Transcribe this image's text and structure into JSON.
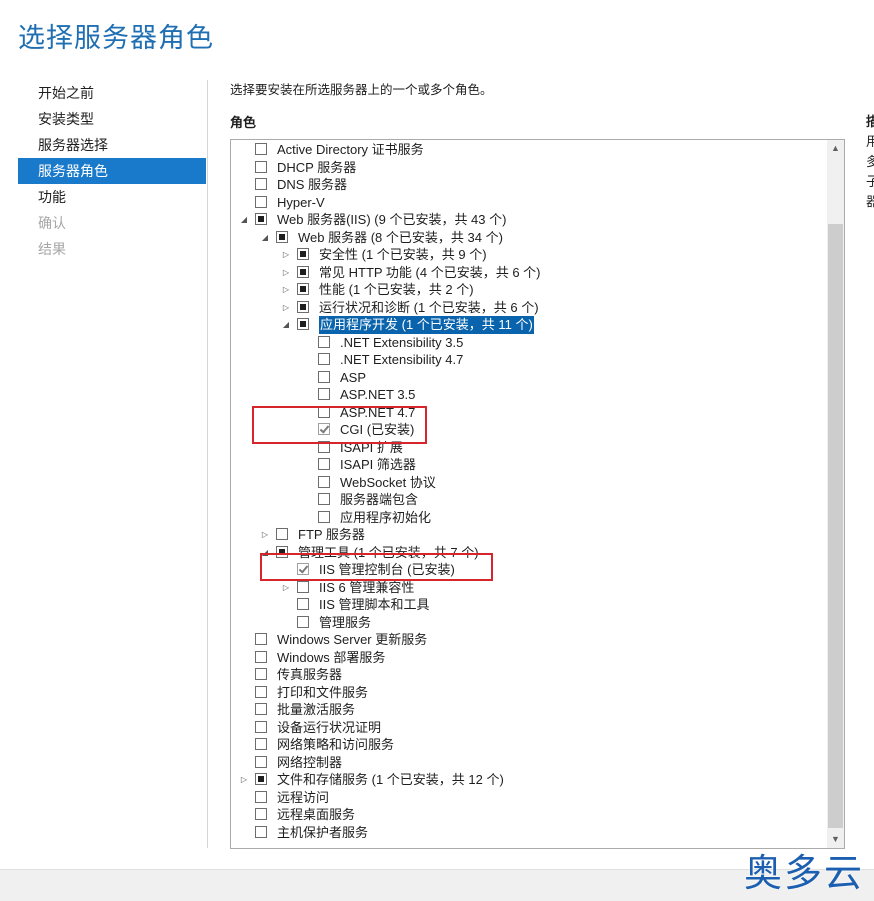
{
  "page": {
    "title": "选择服务器角色",
    "instruction": "选择要安装在所选服务器上的一个或多个角色。",
    "roles_label": "角色",
    "right_panel_fragment": [
      "描",
      "用",
      "多",
      "子",
      "器"
    ]
  },
  "nav": [
    {
      "label": "开始之前",
      "state": "normal"
    },
    {
      "label": "安装类型",
      "state": "normal"
    },
    {
      "label": "服务器选择",
      "state": "normal"
    },
    {
      "label": "服务器角色",
      "state": "selected"
    },
    {
      "label": "功能",
      "state": "normal"
    },
    {
      "label": "确认",
      "state": "disabled"
    },
    {
      "label": "结果",
      "state": "disabled"
    }
  ],
  "roles": [
    {
      "label": "Active Directory 证书服务",
      "level": 0,
      "state": "unchecked",
      "expander": "none"
    },
    {
      "label": "DHCP 服务器",
      "level": 0,
      "state": "unchecked",
      "expander": "none"
    },
    {
      "label": "DNS 服务器",
      "level": 0,
      "state": "unchecked",
      "expander": "none"
    },
    {
      "label": "Hyper-V",
      "level": 0,
      "state": "unchecked",
      "expander": "none"
    },
    {
      "label": "Web 服务器(IIS) (9 个已安装，共 43 个)",
      "level": 0,
      "state": "partial",
      "expander": "expanded"
    },
    {
      "label": "Web 服务器 (8 个已安装，共 34 个)",
      "level": 1,
      "state": "partial",
      "expander": "expanded"
    },
    {
      "label": "安全性 (1 个已安装，共 9 个)",
      "level": 2,
      "state": "partial",
      "expander": "collapsed"
    },
    {
      "label": "常见 HTTP 功能 (4 个已安装，共 6 个)",
      "level": 2,
      "state": "partial",
      "expander": "collapsed"
    },
    {
      "label": "性能 (1 个已安装，共 2 个)",
      "level": 2,
      "state": "partial",
      "expander": "collapsed"
    },
    {
      "label": "运行状况和诊断 (1 个已安装，共 6 个)",
      "level": 2,
      "state": "partial",
      "expander": "collapsed"
    },
    {
      "label": "应用程序开发 (1 个已安装，共 11 个)",
      "level": 2,
      "state": "partial",
      "expander": "expanded",
      "selected": true
    },
    {
      "label": ".NET Extensibility 3.5",
      "level": 3,
      "state": "unchecked",
      "expander": "none"
    },
    {
      "label": ".NET Extensibility 4.7",
      "level": 3,
      "state": "unchecked",
      "expander": "none"
    },
    {
      "label": "ASP",
      "level": 3,
      "state": "unchecked",
      "expander": "none"
    },
    {
      "label": "ASP.NET 3.5",
      "level": 3,
      "state": "unchecked",
      "expander": "none"
    },
    {
      "label": "ASP.NET 4.7",
      "level": 3,
      "state": "unchecked",
      "expander": "none"
    },
    {
      "label": "CGI (已安装)",
      "level": 3,
      "state": "checked",
      "expander": "none"
    },
    {
      "label": "ISAPI 扩展",
      "level": 3,
      "state": "unchecked",
      "expander": "none"
    },
    {
      "label": "ISAPI 筛选器",
      "level": 3,
      "state": "unchecked",
      "expander": "none"
    },
    {
      "label": "WebSocket 协议",
      "level": 3,
      "state": "unchecked",
      "expander": "none"
    },
    {
      "label": "服务器端包含",
      "level": 3,
      "state": "unchecked",
      "expander": "none"
    },
    {
      "label": "应用程序初始化",
      "level": 3,
      "state": "unchecked",
      "expander": "none"
    },
    {
      "label": "FTP 服务器",
      "level": 1,
      "state": "unchecked",
      "expander": "collapsed"
    },
    {
      "label": "管理工具 (1 个已安装，共 7 个)",
      "level": 1,
      "state": "partial",
      "expander": "expanded"
    },
    {
      "label": "IIS 管理控制台 (已安装)",
      "level": 2,
      "state": "checked",
      "expander": "none"
    },
    {
      "label": "IIS 6 管理兼容性",
      "level": 2,
      "state": "unchecked",
      "expander": "collapsed"
    },
    {
      "label": "IIS 管理脚本和工具",
      "level": 2,
      "state": "unchecked",
      "expander": "none"
    },
    {
      "label": "管理服务",
      "level": 2,
      "state": "unchecked",
      "expander": "none"
    },
    {
      "label": "Windows Server 更新服务",
      "level": 0,
      "state": "unchecked",
      "expander": "none"
    },
    {
      "label": "Windows 部署服务",
      "level": 0,
      "state": "unchecked",
      "expander": "none"
    },
    {
      "label": "传真服务器",
      "level": 0,
      "state": "unchecked",
      "expander": "none"
    },
    {
      "label": "打印和文件服务",
      "level": 0,
      "state": "unchecked",
      "expander": "none"
    },
    {
      "label": "批量激活服务",
      "level": 0,
      "state": "unchecked",
      "expander": "none"
    },
    {
      "label": "设备运行状况证明",
      "level": 0,
      "state": "unchecked",
      "expander": "none"
    },
    {
      "label": "网络策略和访问服务",
      "level": 0,
      "state": "unchecked",
      "expander": "none"
    },
    {
      "label": "网络控制器",
      "level": 0,
      "state": "unchecked",
      "expander": "none"
    },
    {
      "label": "文件和存储服务 (1 个已安装，共 12 个)",
      "level": 0,
      "state": "partial",
      "expander": "collapsed"
    },
    {
      "label": "远程访问",
      "level": 0,
      "state": "unchecked",
      "expander": "none"
    },
    {
      "label": "远程桌面服务",
      "level": 0,
      "state": "unchecked",
      "expander": "none"
    },
    {
      "label": "主机保护者服务",
      "level": 0,
      "state": "unchecked",
      "expander": "none"
    }
  ],
  "scrollbar": {
    "up_icon": "▲",
    "down_icon": "▼"
  },
  "icons": {
    "expanded": "◢",
    "collapsed": "▷"
  },
  "colors": {
    "accent": "#1979ca",
    "title": "#1f6fb2",
    "annotation": "#d6262b",
    "selection": "#0a64ad"
  },
  "watermark": "奥多云"
}
